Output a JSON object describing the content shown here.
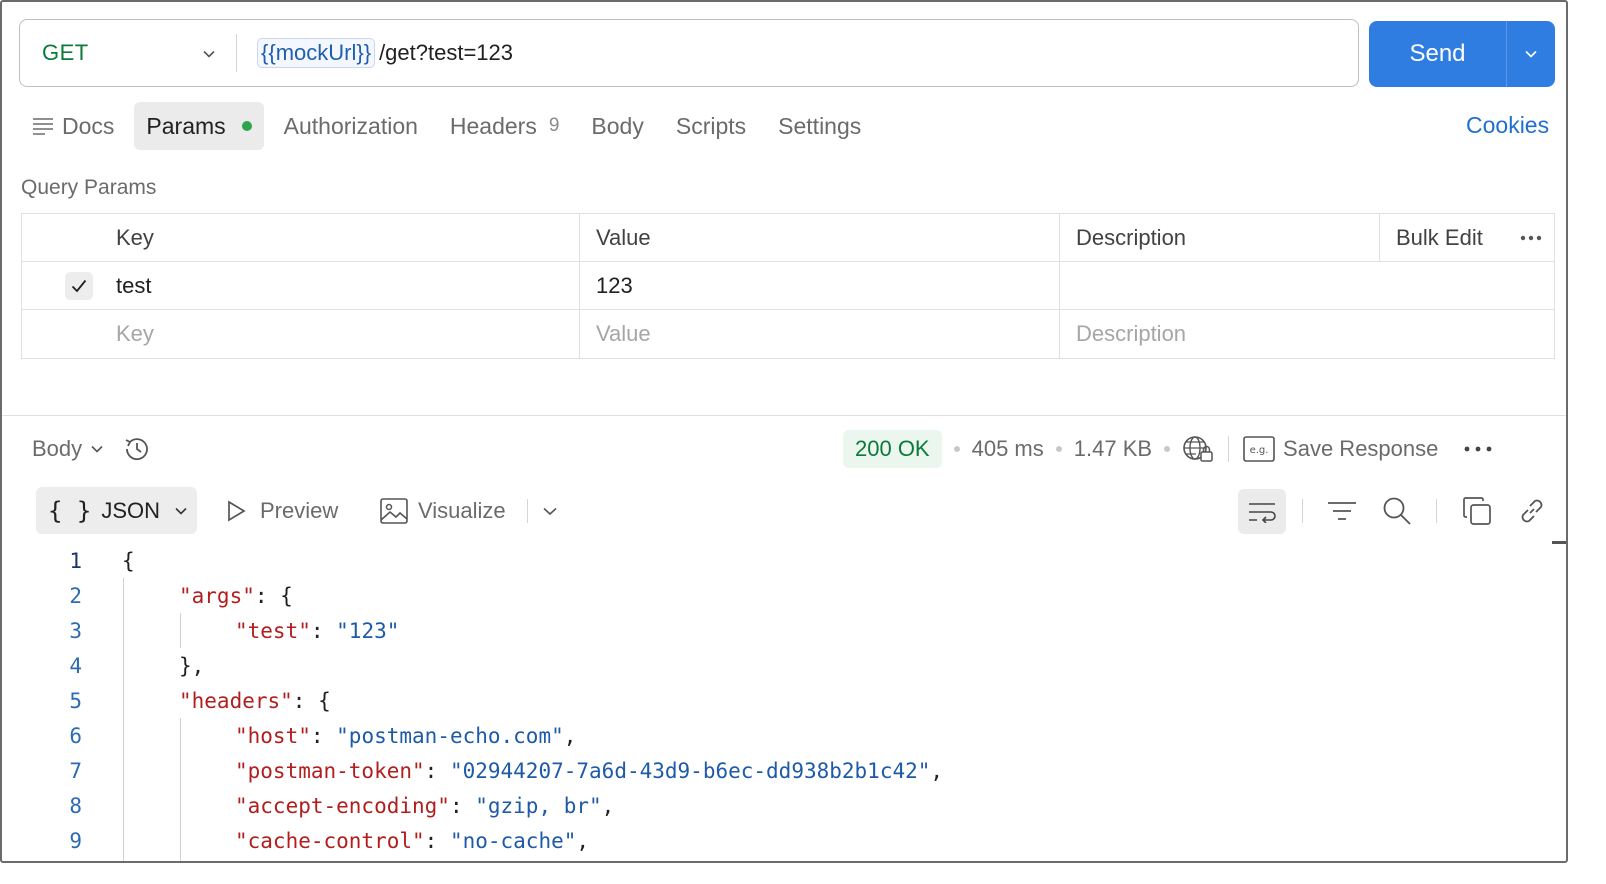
{
  "request": {
    "method": "GET",
    "url_variable": "{{mockUrl}}",
    "url_path": "/get?test=123",
    "send_label": "Send"
  },
  "tabs": [
    {
      "label": "Docs"
    },
    {
      "label": "Params"
    },
    {
      "label": "Authorization"
    },
    {
      "label": "Headers",
      "count": "9"
    },
    {
      "label": "Body"
    },
    {
      "label": "Scripts"
    },
    {
      "label": "Settings"
    }
  ],
  "cookies_label": "Cookies",
  "query_params": {
    "title": "Query Params",
    "headers": {
      "key": "Key",
      "value": "Value",
      "description": "Description",
      "bulk_edit": "Bulk Edit"
    },
    "rows": [
      {
        "checked": true,
        "key": "test",
        "value": "123",
        "description": ""
      }
    ],
    "placeholders": {
      "key": "Key",
      "value": "Value",
      "description": "Description"
    }
  },
  "response": {
    "body_label": "Body",
    "status": "200 OK",
    "time": "405 ms",
    "size": "1.47 KB",
    "save_label": "Save Response",
    "format_label": "JSON",
    "preview_label": "Preview",
    "visualize_label": "Visualize"
  },
  "code_lines": [
    {
      "num": "1",
      "text": "{"
    },
    {
      "num": "2",
      "text": "\"args\": {"
    },
    {
      "num": "3",
      "text": "\"test\": \"123\""
    },
    {
      "num": "4",
      "text": "},"
    },
    {
      "num": "5",
      "text": "\"headers\": {"
    },
    {
      "num": "6",
      "text": "\"host\": \"postman-echo.com\","
    },
    {
      "num": "7",
      "text": "\"postman-token\": \"02944207-7a6d-43d9-b6ec-dd938b2b1c42\","
    },
    {
      "num": "8",
      "text": "\"accept-encoding\": \"gzip, br\","
    },
    {
      "num": "9",
      "text": "\"cache-control\": \"no-cache\","
    }
  ],
  "colors": {
    "accent": "#2f7de1",
    "method": "#0b7a3a",
    "json_key": "#b21e1e",
    "json_string": "#1e5aa8"
  }
}
